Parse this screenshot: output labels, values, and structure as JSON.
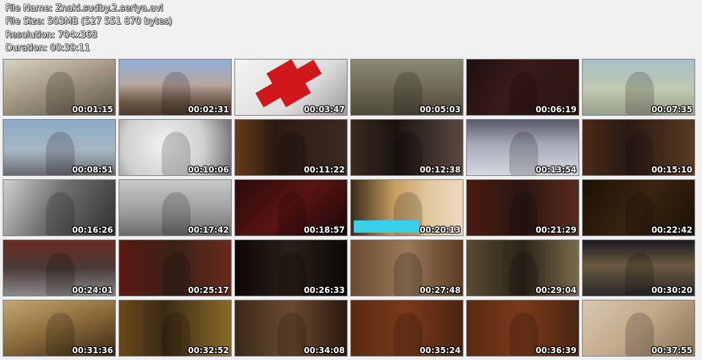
{
  "header": {
    "file_name": "File Name: Znaki.sudby.2.seriya.avi",
    "file_size": "File Size: 503MB (527 551 870 bytes)",
    "resolution": "Resolution: 704x368",
    "duration": "Duration: 00:39:11"
  },
  "thumbnails": [
    {
      "time": "00:01:15",
      "scene": "ruined-building",
      "bg": "linear-gradient(160deg,#d8d2c4 0%,#a59a86 45%,#5b5448 100%)"
    },
    {
      "time": "00:02:31",
      "scene": "train-tracks-dusk",
      "bg": "linear-gradient(180deg,#8fb0d8 0%,#b7a7a0 45%,#6f5a48 75%,#4a3a30 100%)"
    },
    {
      "time": "00:03:47",
      "scene": "red-cross",
      "bg": "linear-gradient(135deg,#f4f4f4 0%,#dcdcdc 60%,#9a9a9a 100%)"
    },
    {
      "time": "00:05:03",
      "scene": "soldiers-stretcher",
      "bg": "linear-gradient(180deg,#8a8a78 0%,#6f6b55 50%,#4c4a3a 100%)"
    },
    {
      "time": "00:06:19",
      "scene": "singer-on-stage",
      "bg": "linear-gradient(120deg,#1a1010 0%,#3a1a18 40%,#2a1612 100%)"
    },
    {
      "time": "00:07:35",
      "scene": "woman-red-hair",
      "bg": "linear-gradient(180deg,#a8c0c8 0%,#c0c8b0 55%,#9aa08a 100%)"
    },
    {
      "time": "00:08:51",
      "scene": "two-men-outdoors",
      "bg": "linear-gradient(180deg,#8eaac8 0%,#a4b6c2 55%,#6a6a70 100%)"
    },
    {
      "time": "00:10:06",
      "scene": "pressure-gauge",
      "bg": "radial-gradient(circle at 40% 45%,#f2f2f2 0%,#cfcfcf 55%,#6a6a6a 100%)"
    },
    {
      "time": "00:11:22",
      "scene": "man-interview-bookshelf",
      "bg": "linear-gradient(90deg,#6a3a1a 0%,#2a1a10 35%,#3a2a20 100%)"
    },
    {
      "time": "00:12:38",
      "scene": "older-man-piano",
      "bg": "linear-gradient(90deg,#3a2a1a 0%,#1a1410 40%,#5a4a40 100%)"
    },
    {
      "time": "00:13:54",
      "scene": "hockey-players",
      "bg": "linear-gradient(180deg,#5a5a6a 0%,#a8aab8 45%,#d6d8e2 100%)"
    },
    {
      "time": "00:15:10",
      "scene": "bald-man-bookshelf",
      "bg": "linear-gradient(90deg,#4a2a18 0%,#2a1a12 40%,#5a3a22 100%)"
    },
    {
      "time": "00:16:26",
      "scene": "radio-operator-bw",
      "bg": "linear-gradient(120deg,#d0d0d0 0%,#707070 45%,#303030 100%)"
    },
    {
      "time": "00:17:42",
      "scene": "airport-window-bw",
      "bg": "linear-gradient(180deg,#c8c8c8 0%,#9a9a9a 60%,#6a6a6a 100%)"
    },
    {
      "time": "00:18:57",
      "scene": "man-theater-seats",
      "bg": "linear-gradient(135deg,#2a0a0a 0%,#5a1414 50%,#1a0606 100%)"
    },
    {
      "time": "00:20:13",
      "scene": "tv-news-woman",
      "bg": "linear-gradient(90deg,#3a2a1a 0%,#c8a060 40%,#e0c8a0 70%,#f0d8c0 100%)"
    },
    {
      "time": "00:21:29",
      "scene": "man-interview-red",
      "bg": "linear-gradient(90deg,#4a1a12 0%,#2a1612 50%,#5a2a1c 100%)"
    },
    {
      "time": "00:22:42",
      "scene": "dancer-costume",
      "bg": "linear-gradient(120deg,#1a1208 0%,#3a2410 50%,#1a1208 100%)"
    },
    {
      "time": "00:24:01",
      "scene": "man-bench-stadium",
      "bg": "linear-gradient(180deg,#6a2a22 0%,#4a3a36 50%,#8a8a8a 100%)"
    },
    {
      "time": "00:25:17",
      "scene": "man-closeup-red",
      "bg": "linear-gradient(90deg,#5a1812 0%,#3a2218 50%,#6a2a1c 100%)"
    },
    {
      "time": "00:26:33",
      "scene": "silhouette-dark",
      "bg": "linear-gradient(90deg,#0a0806 0%,#2a2016 50%,#0a0806 100%)"
    },
    {
      "time": "00:27:48",
      "scene": "woman-interior",
      "bg": "linear-gradient(90deg,#6a4a30 0%,#9a7a5a 50%,#5a3a22 100%)"
    },
    {
      "time": "00:29:04",
      "scene": "priest-interview",
      "bg": "linear-gradient(90deg,#5a4a30 0%,#2a2418 50%,#7a6a4a 100%)"
    },
    {
      "time": "00:30:20",
      "scene": "city-night-river",
      "bg": "linear-gradient(180deg,#1a1a22 0%,#6a5a40 45%,#2a2a2a 100%)"
    },
    {
      "time": "00:31:36",
      "scene": "forest-sepia",
      "bg": "linear-gradient(160deg,#c8a870 0%,#8a6a3a 50%,#3a2a14 100%)"
    },
    {
      "time": "00:32:52",
      "scene": "priest-church",
      "bg": "linear-gradient(90deg,#6a4a1a 0%,#3a2a14 40%,#8a6a2a 100%)"
    },
    {
      "time": "00:34:08",
      "scene": "woman-hooded",
      "bg": "linear-gradient(90deg,#3a2a1a 0%,#6a4a30 50%,#2a1a10 100%)"
    },
    {
      "time": "00:35:24",
      "scene": "woman-cabinet",
      "bg": "linear-gradient(90deg,#5a2a12 0%,#7a3a1a 50%,#4a2410 100%)"
    },
    {
      "time": "00:36:39",
      "scene": "woman-gesturing",
      "bg": "linear-gradient(90deg,#5a2a12 0%,#7a3a1a 50%,#4a2410 100%)"
    },
    {
      "time": "00:37:55",
      "scene": "baby-sleeping",
      "bg": "linear-gradient(135deg,#d8c8b0 0%,#c0a888 50%,#8a7258 100%)"
    }
  ]
}
